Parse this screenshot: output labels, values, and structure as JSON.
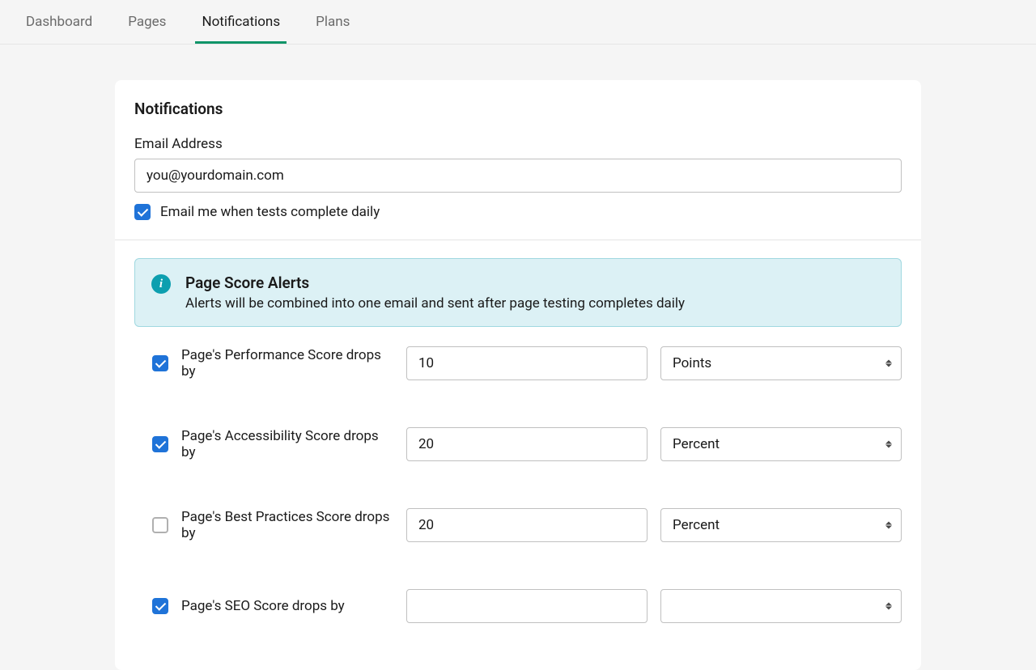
{
  "nav": {
    "items": [
      {
        "label": "Dashboard",
        "active": false
      },
      {
        "label": "Pages",
        "active": false
      },
      {
        "label": "Notifications",
        "active": true
      },
      {
        "label": "Plans",
        "active": false
      }
    ]
  },
  "notifications": {
    "title": "Notifications",
    "email_label": "Email Address",
    "email_value": "you@yourdomain.com",
    "daily_checkbox_checked": true,
    "daily_checkbox_label": "Email me when tests complete daily"
  },
  "page_score_alerts": {
    "title": "Page Score Alerts",
    "description": "Alerts will be combined into one email and sent after page testing completes daily",
    "rows": [
      {
        "checked": true,
        "label": "Page's Performance Score drops by",
        "value": "10",
        "unit": "Points"
      },
      {
        "checked": true,
        "label": "Page's Accessibility Score drops by",
        "value": "20",
        "unit": "Percent"
      },
      {
        "checked": false,
        "label": "Page's Best Practices Score drops by",
        "value": "20",
        "unit": "Percent"
      },
      {
        "checked": true,
        "label": "Page's SEO Score drops by",
        "value": "",
        "unit": ""
      }
    ],
    "unit_options": [
      "Points",
      "Percent"
    ]
  }
}
